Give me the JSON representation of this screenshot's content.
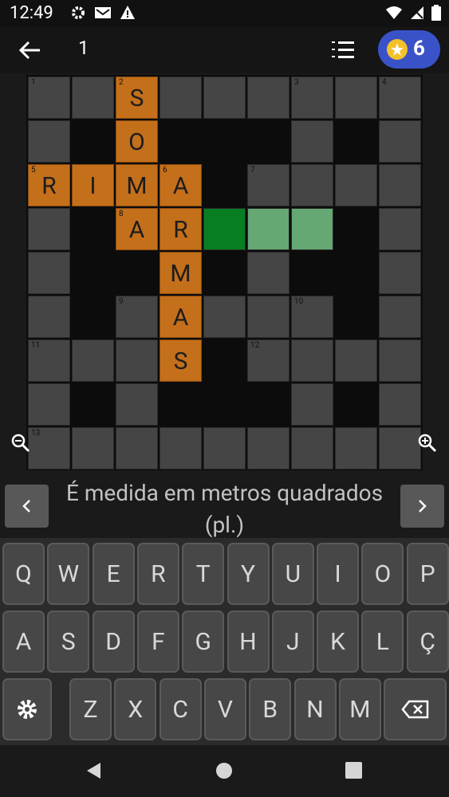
{
  "status_bar": {
    "time": "12:49"
  },
  "toolbar": {
    "level": "1",
    "coins": "6"
  },
  "board": {
    "cells": [
      {
        "r": 0,
        "c": 0,
        "num": "1"
      },
      {
        "r": 0,
        "c": 1
      },
      {
        "r": 0,
        "c": 2,
        "num": "2",
        "letter": "S"
      },
      {
        "r": 0,
        "c": 3
      },
      {
        "r": 0,
        "c": 4
      },
      {
        "r": 0,
        "c": 5
      },
      {
        "r": 0,
        "c": 6,
        "num": "3"
      },
      {
        "r": 0,
        "c": 7
      },
      {
        "r": 0,
        "c": 8,
        "num": "4"
      },
      {
        "r": 1,
        "c": 0
      },
      {
        "r": 1,
        "c": 2,
        "letter": "O"
      },
      {
        "r": 1,
        "c": 6
      },
      {
        "r": 1,
        "c": 8
      },
      {
        "r": 2,
        "c": 0,
        "num": "5",
        "letter": "R"
      },
      {
        "r": 2,
        "c": 1,
        "letter": "I"
      },
      {
        "r": 2,
        "c": 2,
        "letter": "M"
      },
      {
        "r": 2,
        "c": 3,
        "num": "6",
        "letter": "A"
      },
      {
        "r": 2,
        "c": 5,
        "num": "7"
      },
      {
        "r": 2,
        "c": 6
      },
      {
        "r": 2,
        "c": 7
      },
      {
        "r": 2,
        "c": 8
      },
      {
        "r": 3,
        "c": 0
      },
      {
        "r": 3,
        "c": 2,
        "num": "8",
        "letter": "A"
      },
      {
        "r": 3,
        "c": 3,
        "letter": "R"
      },
      {
        "r": 3,
        "c": 4,
        "state": "cursor"
      },
      {
        "r": 3,
        "c": 5,
        "state": "sel"
      },
      {
        "r": 3,
        "c": 6,
        "state": "sel"
      },
      {
        "r": 3,
        "c": 8
      },
      {
        "r": 4,
        "c": 0
      },
      {
        "r": 4,
        "c": 3,
        "letter": "M"
      },
      {
        "r": 4,
        "c": 5
      },
      {
        "r": 4,
        "c": 8
      },
      {
        "r": 5,
        "c": 0
      },
      {
        "r": 5,
        "c": 2,
        "num": "9"
      },
      {
        "r": 5,
        "c": 3,
        "letter": "A"
      },
      {
        "r": 5,
        "c": 4
      },
      {
        "r": 5,
        "c": 5
      },
      {
        "r": 5,
        "c": 6,
        "num": "10"
      },
      {
        "r": 5,
        "c": 8
      },
      {
        "r": 6,
        "c": 0,
        "num": "11"
      },
      {
        "r": 6,
        "c": 1
      },
      {
        "r": 6,
        "c": 2
      },
      {
        "r": 6,
        "c": 3,
        "letter": "S"
      },
      {
        "r": 6,
        "c": 5,
        "num": "12"
      },
      {
        "r": 6,
        "c": 6
      },
      {
        "r": 6,
        "c": 7
      },
      {
        "r": 6,
        "c": 8
      },
      {
        "r": 7,
        "c": 0
      },
      {
        "r": 7,
        "c": 2
      },
      {
        "r": 7,
        "c": 6
      },
      {
        "r": 7,
        "c": 8
      },
      {
        "r": 8,
        "c": 0,
        "num": "13"
      },
      {
        "r": 8,
        "c": 1
      },
      {
        "r": 8,
        "c": 2
      },
      {
        "r": 8,
        "c": 3
      },
      {
        "r": 8,
        "c": 4
      },
      {
        "r": 8,
        "c": 5
      },
      {
        "r": 8,
        "c": 6
      },
      {
        "r": 8,
        "c": 7
      },
      {
        "r": 8,
        "c": 8
      }
    ]
  },
  "clue": {
    "text": "É medida em metros quadrados (pl.)"
  },
  "keyboard": {
    "row1": [
      "Q",
      "W",
      "E",
      "R",
      "T",
      "Y",
      "U",
      "I",
      "O",
      "P"
    ],
    "row2": [
      "A",
      "S",
      "D",
      "F",
      "G",
      "H",
      "J",
      "K",
      "L",
      "Ç"
    ],
    "row3": [
      "Z",
      "X",
      "C",
      "V",
      "B",
      "N",
      "M"
    ]
  },
  "colors": {
    "filled": "#c46f1a",
    "cursor": "#077e22",
    "selected": "#66a873",
    "coin_badge": "#3a52c8"
  }
}
